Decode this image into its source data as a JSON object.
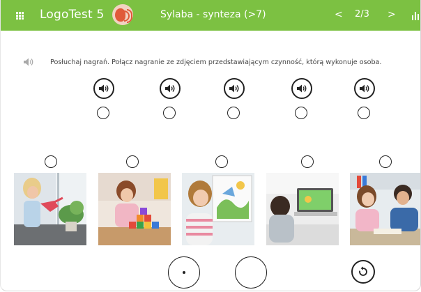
{
  "header": {
    "app_title": "LogoTest 5",
    "section_title": "Sylaba - synteza (>7)",
    "nav_prev": "<",
    "page": "2/3",
    "nav_next": ">",
    "background": "#7cc142"
  },
  "instruction": {
    "text": "Posłuchaj nagrań. Połącz nagranie ze zdjęciem przedstawiającym czynność, którą wykonuje osoba."
  },
  "audio_items": [
    "speaker-icon",
    "speaker-icon",
    "speaker-icon",
    "speaker-icon",
    "speaker-icon"
  ],
  "photos": [
    "girl-watering-plants-photo",
    "girl-building-blocks-photo",
    "girl-painting-easel-photo",
    "boy-using-laptop-photo",
    "children-talking-photo"
  ],
  "icons": {
    "menu": "grid-icon",
    "logo": "speaking-head-icon",
    "stats": "bar-chart-icon",
    "reset": "reset-icon"
  }
}
